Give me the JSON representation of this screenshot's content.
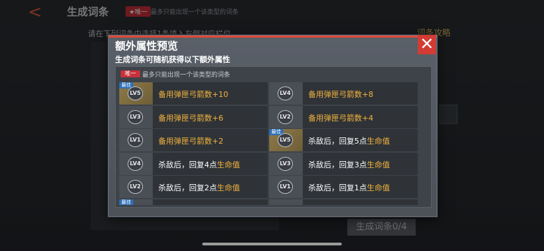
{
  "background": {
    "title": "生成词条",
    "unique_badge": "★唯一",
    "note": "最多只能出现一个该类型的词条",
    "instruction": "请在下列词条中选择1条填入左侧对应栏位",
    "strategy": "词条攻略",
    "generate_button": "生成词条0/4"
  },
  "dialog": {
    "title": "额外属性预览",
    "subtitle": "生成词条可随机获得以下额外属性",
    "close_symbol": "✕",
    "unique_badge": "唯一",
    "unique_note": "最多只能出现一个该类型的词条",
    "best_label": "最佳",
    "entries": [
      {
        "level": "LV5",
        "best": true,
        "prefix": "",
        "highlight": "备用弹匣弓箭数+10",
        "suffix": ""
      },
      {
        "level": "LV4",
        "best": false,
        "prefix": "",
        "highlight": "备用弹匣弓箭数+8",
        "suffix": ""
      },
      {
        "level": "LV3",
        "best": false,
        "prefix": "",
        "highlight": "备用弹匣弓箭数+6",
        "suffix": ""
      },
      {
        "level": "LV2",
        "best": false,
        "prefix": "",
        "highlight": "备用弹匣弓箭数+4",
        "suffix": ""
      },
      {
        "level": "LV1",
        "best": false,
        "prefix": "",
        "highlight": "备用弹匣弓箭数+2",
        "suffix": ""
      },
      {
        "level": "LV5",
        "best": true,
        "prefix": "杀敌后，回复5点",
        "highlight": "生命值",
        "suffix": ""
      },
      {
        "level": "LV4",
        "best": false,
        "prefix": "杀敌后，回复4点",
        "highlight": "生命值",
        "suffix": ""
      },
      {
        "level": "LV3",
        "best": false,
        "prefix": "杀敌后，回复3点",
        "highlight": "生命值",
        "suffix": ""
      },
      {
        "level": "LV2",
        "best": false,
        "prefix": "杀敌后，回复2点",
        "highlight": "生命值",
        "suffix": ""
      },
      {
        "level": "LV1",
        "best": false,
        "prefix": "杀敌后，回复1点",
        "highlight": "生命值",
        "suffix": ""
      }
    ]
  }
}
